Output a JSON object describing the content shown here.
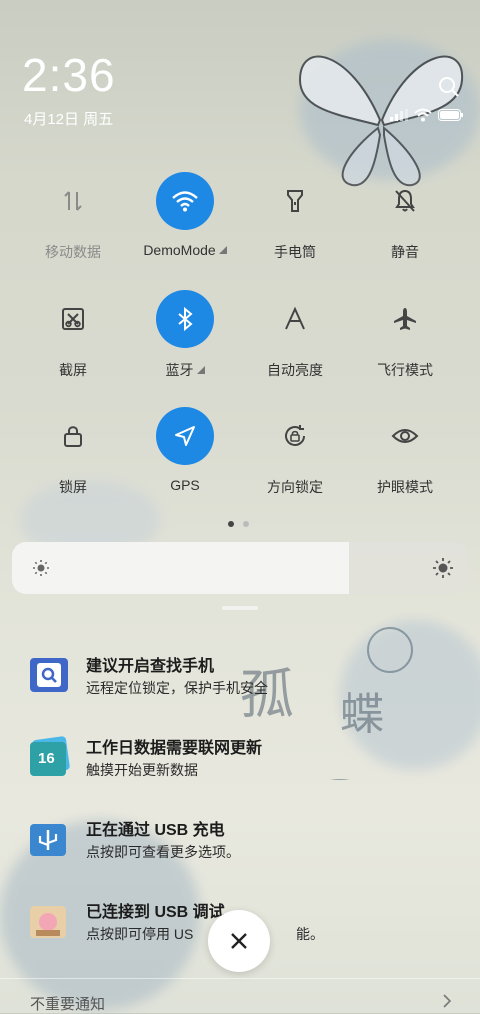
{
  "status": {
    "time": "2:36",
    "date": "4月12日 周五"
  },
  "quick_tiles": [
    {
      "label": "移动数据",
      "icon": "mobile-data-icon",
      "active": false
    },
    {
      "label": "DemoMode",
      "icon": "wifi-icon",
      "active": true
    },
    {
      "label": "手电筒",
      "icon": "flashlight-icon",
      "active": false
    },
    {
      "label": "静音",
      "icon": "mute-icon",
      "active": false
    },
    {
      "label": "截屏",
      "icon": "screenshot-icon",
      "active": false
    },
    {
      "label": "蓝牙",
      "icon": "bluetooth-icon",
      "active": true
    },
    {
      "label": "自动亮度",
      "icon": "auto-brightness-icon",
      "active": false
    },
    {
      "label": "飞行模式",
      "icon": "airplane-icon",
      "active": false
    },
    {
      "label": "锁屏",
      "icon": "lock-icon",
      "active": false
    },
    {
      "label": "GPS",
      "icon": "gps-icon",
      "active": true
    },
    {
      "label": "方向锁定",
      "icon": "rotation-lock-icon",
      "active": false
    },
    {
      "label": "护眼模式",
      "icon": "eye-icon",
      "active": false
    }
  ],
  "brightness": {
    "level": 0.74
  },
  "notifications": [
    {
      "title": "建议开启查找手机",
      "body": "远程定位锁定，保护手机安全",
      "icon": "find-phone-app-icon"
    },
    {
      "title": "工作日数据需要联网更新",
      "body": "触摸开始更新数据",
      "icon": "calendar-app-icon",
      "badge": "16"
    },
    {
      "title": "正在通过 USB 充电",
      "body": "点按即可查看更多选项。",
      "icon": "usb-app-icon"
    },
    {
      "title": "已连接到 USB 调试",
      "body": "点按即可停用 US",
      "body_tail": "能。",
      "icon": "android-app-icon"
    }
  ],
  "footer": {
    "label": "不重要通知"
  },
  "colors": {
    "accent": "#1e88e5"
  }
}
